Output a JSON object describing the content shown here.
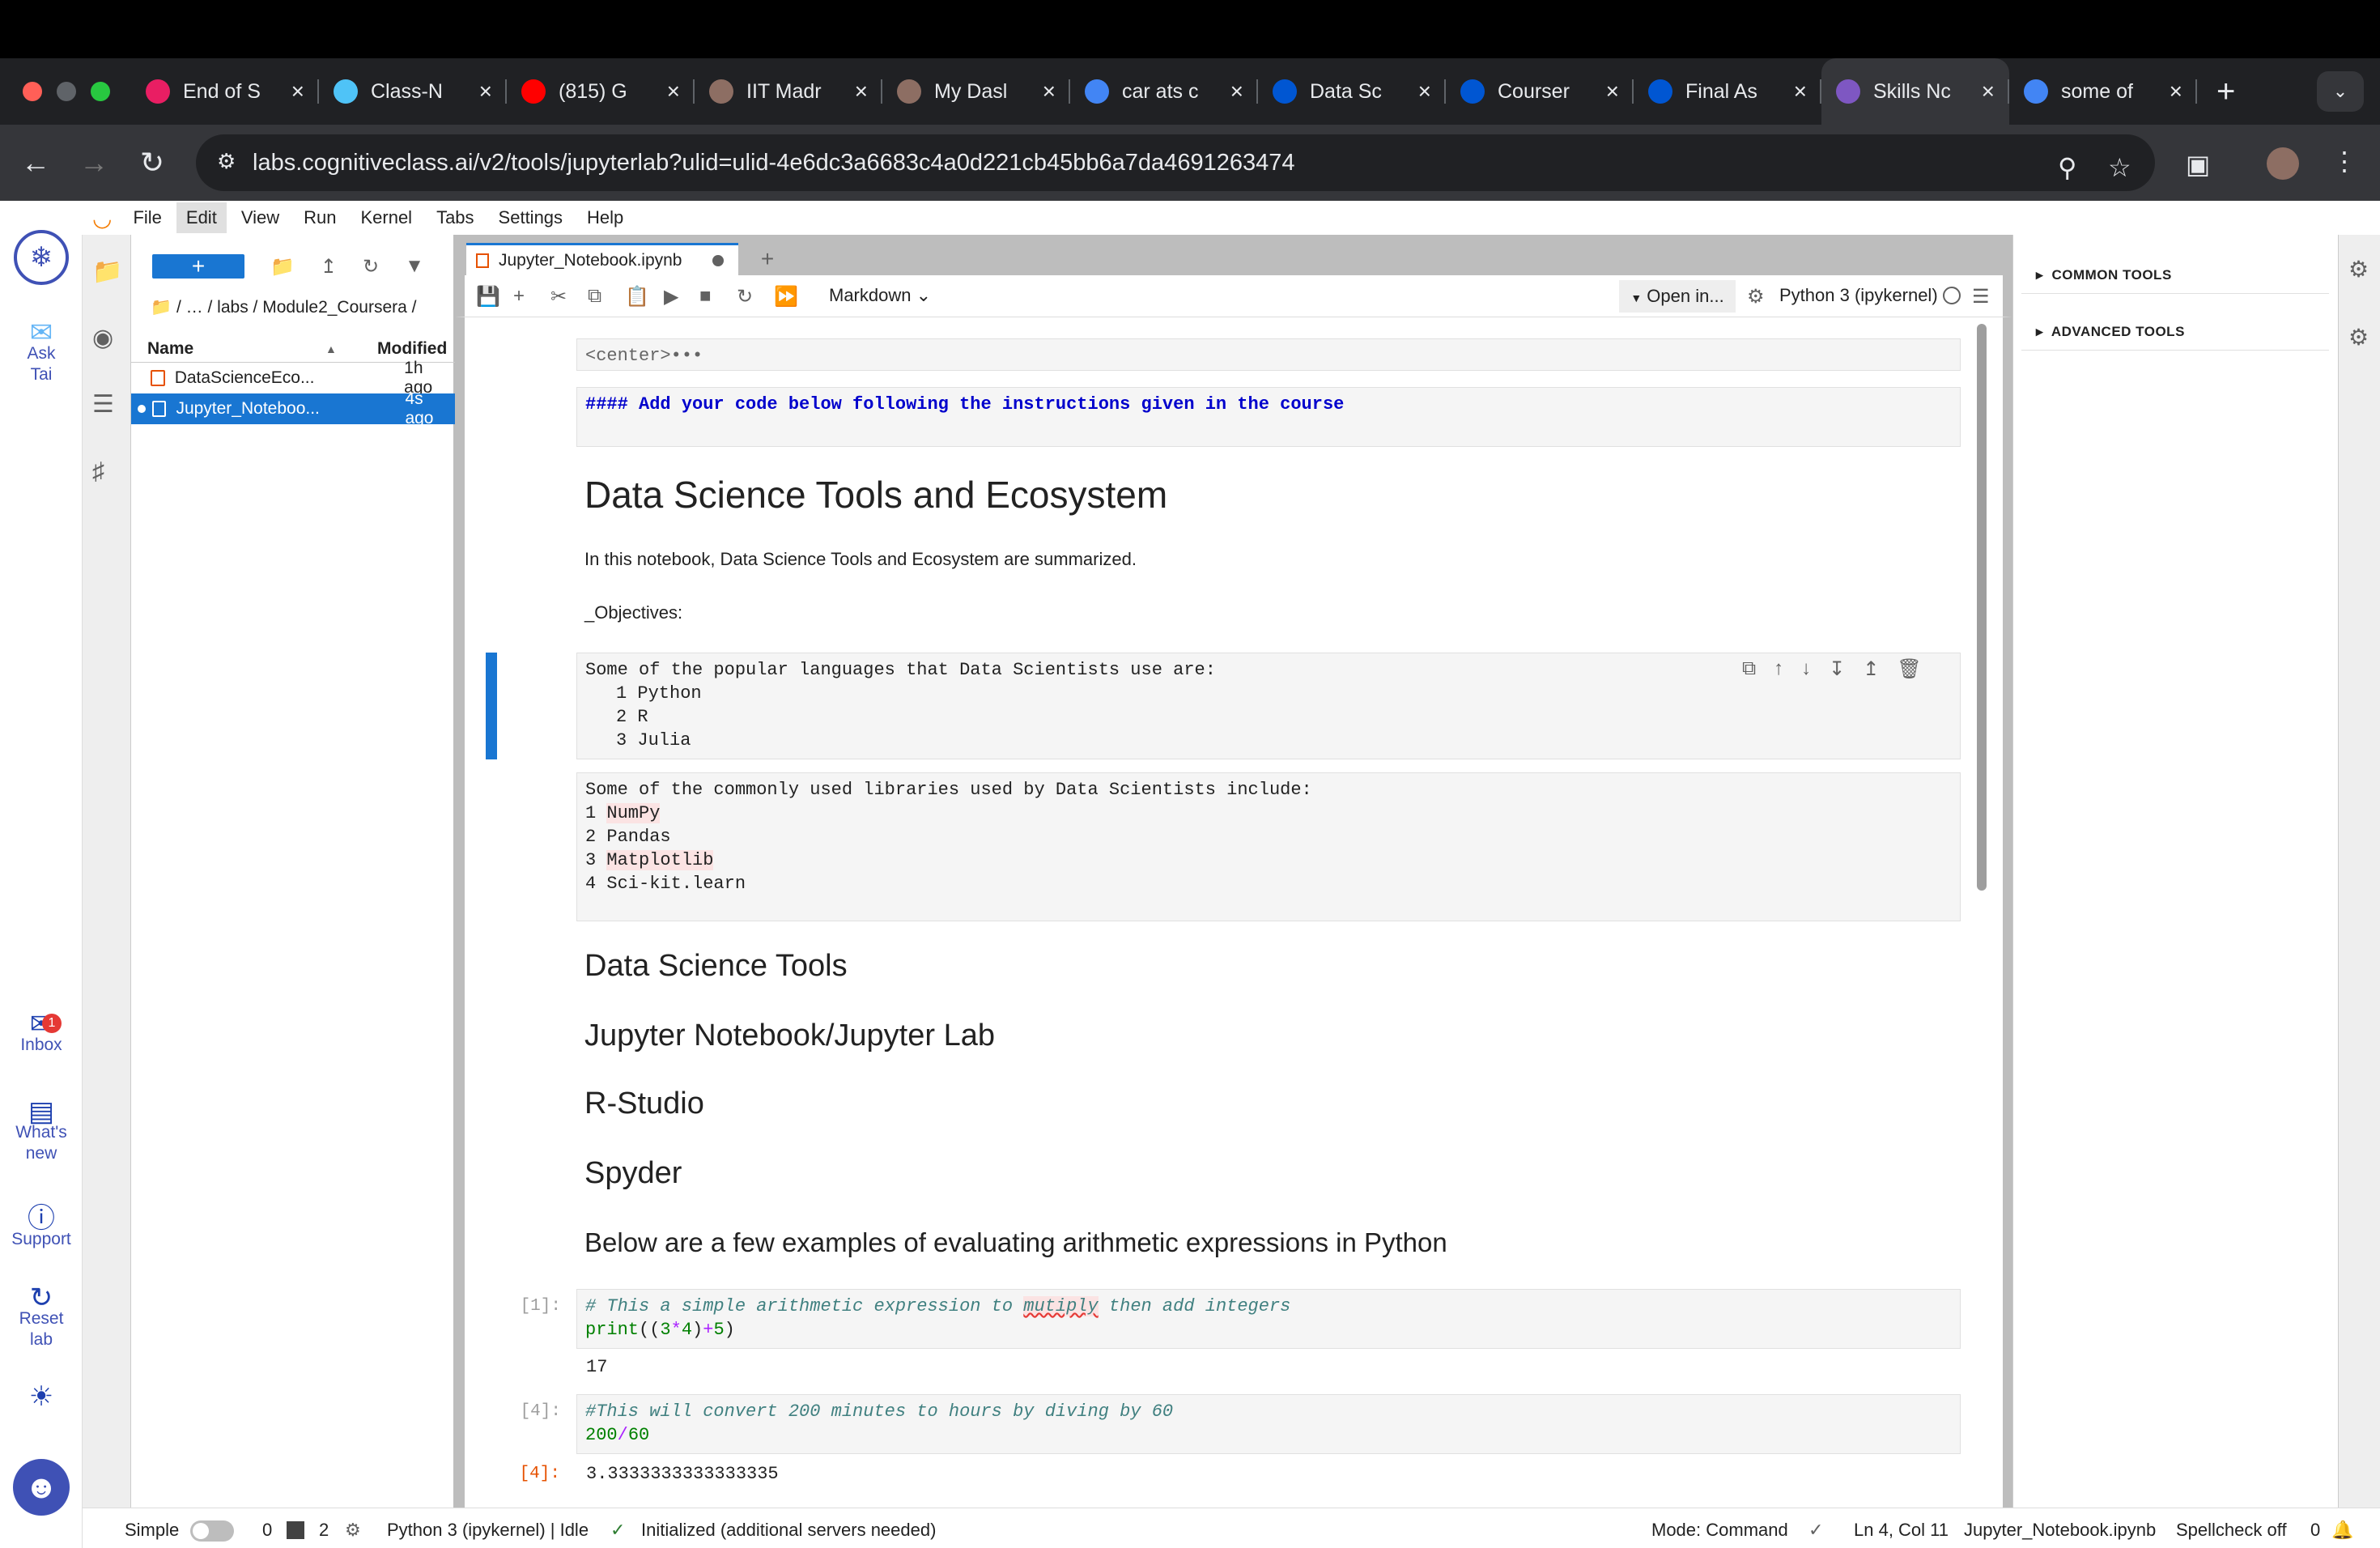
{
  "browser": {
    "tabs": [
      {
        "title": "End of S",
        "icon": "myntra-icon",
        "color": "#e91e63"
      },
      {
        "title": "Class-N",
        "icon": "class-icon",
        "color": "#4fc3f7"
      },
      {
        "title": "(815) G",
        "icon": "youtube-icon",
        "color": "#ff0000"
      },
      {
        "title": "IIT Madr",
        "icon": "avatar-icon",
        "color": "#8d6e63"
      },
      {
        "title": "My Dasl",
        "icon": "avatar-icon",
        "color": "#8d6e63"
      },
      {
        "title": "car ats c",
        "icon": "google-icon",
        "color": "#4285f4"
      },
      {
        "title": "Data Sc",
        "icon": "coursera-icon",
        "color": "#0056d2"
      },
      {
        "title": "Courser",
        "icon": "coursera-icon",
        "color": "#0056d2"
      },
      {
        "title": "Final As",
        "icon": "coursera-icon",
        "color": "#0056d2"
      },
      {
        "title": "Skills Nc",
        "icon": "skills-icon",
        "color": "#7e57c2",
        "active": true
      },
      {
        "title": "some of",
        "icon": "google-icon",
        "color": "#4285f4"
      }
    ],
    "url": "labs.cognitiveclass.ai/v2/tools/jupyterlab?ulid=ulid-4e6dc3a6683c4a0d221cb45bb6a7da4691263474"
  },
  "menubar": [
    "File",
    "Edit",
    "View",
    "Run",
    "Kernel",
    "Tabs",
    "Settings",
    "Help"
  ],
  "leftside": {
    "ask": "Ask\nTai",
    "inbox": "Inbox",
    "inbox_badge": "1",
    "whats_new": "What's\nnew",
    "support": "Support",
    "reset": "Reset\nlab"
  },
  "filebrowser": {
    "new_label": "+",
    "breadcrumb": "/   …  / labs / Module2_Coursera /",
    "col_name": "Name",
    "col_modified": "Modified",
    "files": [
      {
        "name": "DataScienceEco...",
        "modified": "1h ago",
        "selected": false
      },
      {
        "name": "Jupyter_Noteboo...",
        "modified": "4s ago",
        "selected": true
      }
    ]
  },
  "notebook": {
    "tab_title": "Jupyter_Notebook.ipynb",
    "cell_type": "Markdown",
    "open_in": "Open in...",
    "kernel": "Python 3 (ipykernel)",
    "cells": {
      "center": "<center>•••",
      "instructions": "#### Add your code below following the instructions given in the course",
      "title": "Data Science Tools and Ecosystem",
      "intro": "In this notebook, Data Science Tools and Ecosystem are summarized.",
      "objectives": "_Objectives:",
      "languages_head": "Some of the popular languages that Data Scientists use are:",
      "languages": [
        "1 Python",
        "2 R",
        "3 Julia"
      ],
      "libraries_head": "Some of the commonly used libraries used by Data Scientists include:",
      "libraries": [
        {
          "num": "1 ",
          "name": "NumPy",
          "hl": true
        },
        {
          "num": "2 ",
          "name": "Pandas",
          "hl": false
        },
        {
          "num": "3 ",
          "name": "Matplotlib",
          "hl": true
        },
        {
          "num": "4 ",
          "name": "Sci-kit.learn",
          "hl": false
        }
      ],
      "tools_head": "Data Science Tools",
      "tools": [
        "Jupyter Notebook/Jupyter Lab",
        "R-Studio",
        "Spyder"
      ],
      "arith_head": "Below are a few examples of evaluating arithmetic expressions in Python",
      "code1_prompt": "[1]:",
      "code1_comment_a": "# This a simple arithmetic expression to ",
      "code1_comment_b": "mutiply",
      "code1_comment_c": " then add integers",
      "code1_line2_fn": "print",
      "code1_line2_a": "((",
      "code1_line2_b": "3",
      "code1_line2_c": "*",
      "code1_line2_d": "4",
      "code1_line2_e": ")",
      "code1_line2_f": "+",
      "code1_line2_g": "5",
      "code1_line2_h": ")",
      "out1": "17",
      "code2_prompt": "[4]:",
      "code2_comment": "#This will convert 200 minutes to hours by diving by 60",
      "code2_a": "200",
      "code2_b": "/",
      "code2_c": "60",
      "out2_prompt": "[4]:",
      "out2": "3.3333333333333335"
    }
  },
  "rightpanel": {
    "common": "COMMON TOOLS",
    "advanced": "ADVANCED TOOLS"
  },
  "statusbar": {
    "simple": "Simple",
    "count1": "0",
    "count2": "2",
    "kernel_status": "Python 3 (ipykernel) | Idle",
    "init": "Initialized (additional servers needed)",
    "mode": "Mode: Command",
    "position": "Ln 4, Col 11",
    "file": "Jupyter_Notebook.ipynb",
    "spellcheck": "Spellcheck off",
    "notifications": "0"
  },
  "colors": {
    "accent": "#1976d2",
    "cell_selected": "#1976d2",
    "brand": "#3f51b5"
  }
}
